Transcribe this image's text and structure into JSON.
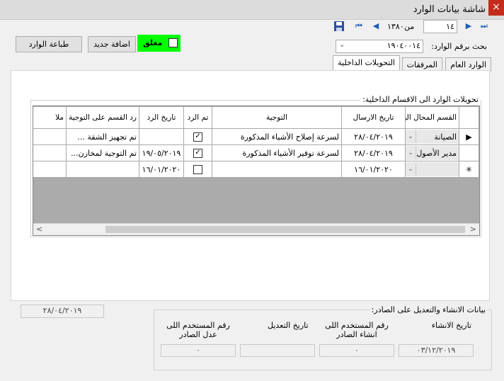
{
  "window": {
    "title": "شاشة بيانات الوارد",
    "close_glyph": "×"
  },
  "toolbar": {
    "record_position": "١٤",
    "of_label": "من",
    "record_total": "١٣٨٠",
    "save_icon": "save-icon",
    "first_glyph": "⏮",
    "prev_glyph": "◀",
    "next_glyph": "▶",
    "last_glyph": "⏭"
  },
  "buttons": {
    "print": "طباعة الوارد",
    "add_new": "اضافة جديد"
  },
  "closed_toggle": {
    "label": "مغلق",
    "checked": false,
    "color": "#00ff00"
  },
  "search": {
    "label": "بحث برقم الوارد:",
    "value": "١٩٠٤٠٠١٤"
  },
  "tabs": [
    {
      "label": "الوارد العام",
      "active": false
    },
    {
      "label": "المرفقات",
      "active": false
    },
    {
      "label": "التحويلات الداخلية",
      "active": true
    }
  ],
  "transfers": {
    "group_label": "تحويلات الوارد الى الاقسام الداخلية:",
    "columns": [
      "القسم المحال اليه",
      "تاريخ الارسال",
      "التوجية",
      "تم الرد",
      "تاريخ الرد",
      "رد القسم على التوجية",
      "ملا"
    ],
    "rows": [
      {
        "dept": "الصيانة",
        "sent": "٢٨/٠٤/٢٠١٩",
        "direction": "لسرعة إصلاح الأشياء المذكورة",
        "replied": true,
        "reply_date": "",
        "reply": "تم تجهيز الشقة ...",
        "current": true
      },
      {
        "dept": "مدير الأصول",
        "sent": "٢٨/٠٤/٢٠١٩",
        "direction": "لسرعة توفير الأشياء المذكورة",
        "replied": true,
        "reply_date": "١٩/٠٥/٢٠١٩",
        "reply": "تم التوجية لمخازن...",
        "current": false
      },
      {
        "dept": "",
        "sent": "١٦/٠١/٢٠٢٠",
        "direction": "",
        "replied": false,
        "reply_date": "١٦/٠١/٢٠٢٠",
        "reply": "",
        "current": false,
        "new": true
      }
    ],
    "row_marker": "▶",
    "new_marker": "✳"
  },
  "footer": {
    "left_date": "٢٨/٠٤/٢٠١٩",
    "audit_label": "بيانات الانشاء والتعديل على الصادر:",
    "created_date_label": "تاريخ الانشاء",
    "created_by_label": "رقم المستخدم اللى انشاء الصادر",
    "modified_date_label": "تاريخ التعديل",
    "modified_by_label": "رقم المستخدم اللى عدل الصادر",
    "created_date": "٠٣/١٢/٢٠١٩",
    "created_by": "٠",
    "modified_date": "",
    "modified_by": "٠"
  }
}
